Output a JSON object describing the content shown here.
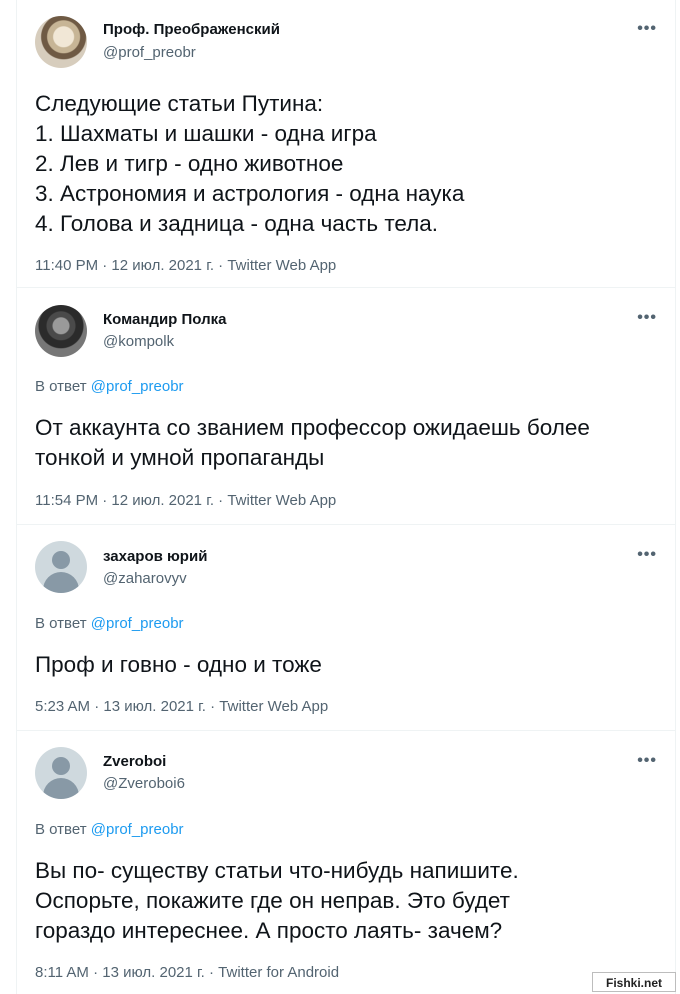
{
  "tweets": [
    {
      "name": "Проф. Преображенский",
      "handle": "@prof_preobr",
      "more": "•••",
      "lines": [
        "Следующие статьи Путина:",
        "1. Шахматы и шашки - одна игра",
        "2. Лев и тигр - одно животное",
        "3. Астрономия и астрология - одна наука",
        "4. Голова и задница - одна часть тела."
      ],
      "meta": "11:40 PM · 12 июл. 2021 г. · Twitter Web App"
    },
    {
      "name": "Командир Полка",
      "handle": "@kompolk",
      "more": "•••",
      "reply_prefix": "В ответ",
      "reply_mention": "@prof_preobr",
      "lines": [
        "От аккаунта со званием профессор ожидаешь более",
        "тонкой и умной пропаганды"
      ],
      "meta": "11:54 PM · 12 июл. 2021 г. · Twitter Web App"
    },
    {
      "name": "захаров юрий",
      "handle": "@zaharovyv",
      "more": "•••",
      "reply_prefix": "В ответ",
      "reply_mention": "@prof_preobr",
      "lines": [
        "Проф и говно - одно и тоже"
      ],
      "meta": "5:23 AM · 13 июл. 2021 г. · Twitter Web App"
    },
    {
      "name": "Zveroboi",
      "handle": "@Zveroboi6",
      "more": "•••",
      "reply_prefix": "В ответ",
      "reply_mention": "@prof_preobr",
      "lines": [
        "Вы по- существу статьи что-нибудь напишите.",
        "Оспорьте, покажите где он неправ. Это будет",
        "гораздо интереснее. А просто лаять- зачем?"
      ],
      "meta": "8:11 AM · 13 июл. 2021 г. · Twitter for Android"
    }
  ],
  "watermark": "Fishki.net"
}
